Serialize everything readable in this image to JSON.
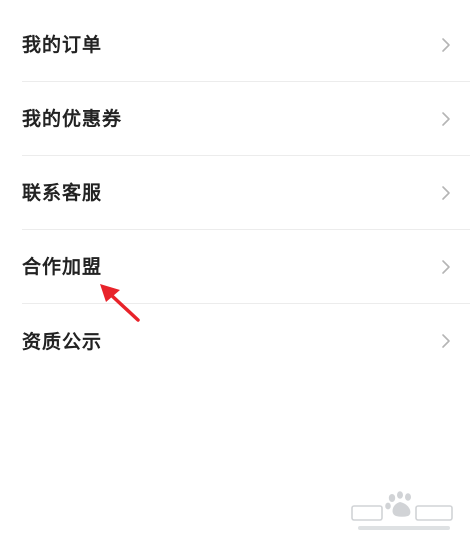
{
  "menu": {
    "items": [
      {
        "label": "我的订单"
      },
      {
        "label": "我的优惠券"
      },
      {
        "label": "联系客服"
      },
      {
        "label": "合作加盟"
      },
      {
        "label": "资质公示"
      }
    ]
  },
  "icons": {
    "chevron": "chevron-right-icon",
    "annotation": "red-arrow-annotation"
  },
  "colors": {
    "text": "#222222",
    "chevron": "#b5b5b5",
    "divider": "#ececec",
    "annotation": "#e8232a"
  }
}
